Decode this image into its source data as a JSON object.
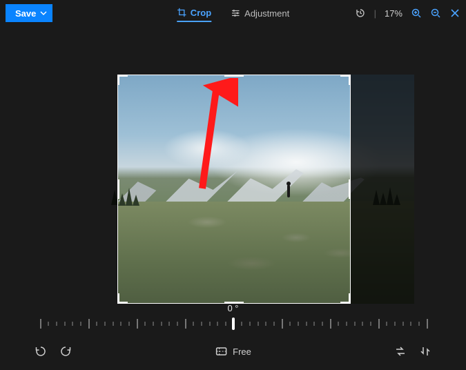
{
  "toolbar": {
    "save_label": "Save",
    "tabs": {
      "crop": "Crop",
      "adjustment": "Adjustment"
    },
    "zoom_percent": "17%"
  },
  "rotation": {
    "angle_label": "0 °",
    "angle_value": 0
  },
  "bottom": {
    "aspect_label": "Free"
  },
  "icons": {
    "crop": "crop-icon",
    "adjustment": "sliders-icon",
    "history": "history-icon",
    "zoom_in": "zoom-in-icon",
    "zoom_out": "zoom-out-icon",
    "close": "close-icon",
    "rotate_ccw": "rotate-ccw-icon",
    "rotate_cw": "rotate-cw-icon",
    "aspect": "aspect-icon",
    "flip_h": "flip-horizontal-icon",
    "flip_v": "flip-vertical-icon",
    "chevron_down": "chevron-down-icon"
  },
  "annotation": {
    "arrow": "red-arrow-pointing-to-crop-tab"
  }
}
